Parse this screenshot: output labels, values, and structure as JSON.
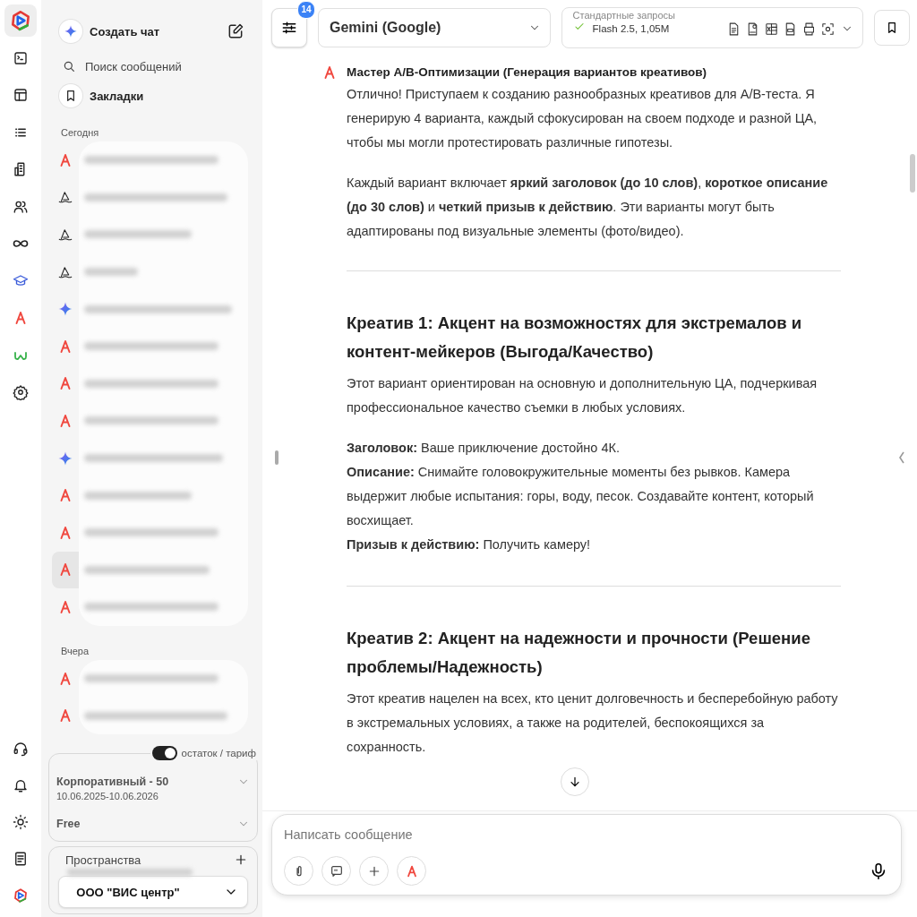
{
  "rail": {
    "top": [
      {
        "kind": "logo",
        "selected": true
      },
      {
        "kind": "terminal",
        "selected": false
      },
      {
        "kind": "layout",
        "selected": false
      },
      {
        "kind": "list",
        "selected": false
      },
      {
        "kind": "building",
        "selected": false
      },
      {
        "kind": "users",
        "selected": false
      },
      {
        "kind": "infinity",
        "selected": false
      },
      {
        "kind": "graduation",
        "selected": false
      },
      {
        "kind": "assistant",
        "selected": false
      },
      {
        "kind": "omega",
        "selected": false
      },
      {
        "kind": "settings",
        "selected": false
      }
    ],
    "bottom": [
      {
        "kind": "headset"
      },
      {
        "kind": "bell"
      },
      {
        "kind": "sun"
      },
      {
        "kind": "document"
      },
      {
        "kind": "logo"
      }
    ]
  },
  "sidebar": {
    "new_chat": "Создать чат",
    "search": {
      "placeholder": "Поиск сообщений"
    },
    "bookmarks": "Закладки",
    "groups": [
      {
        "label": "Сегодня",
        "chats": [
          {
            "kind": "assistant",
            "selected": false
          },
          {
            "kind": "sail",
            "selected": false
          },
          {
            "kind": "sail",
            "selected": false
          },
          {
            "kind": "sail",
            "selected": false
          },
          {
            "kind": "gemini",
            "selected": false
          },
          {
            "kind": "assistant",
            "selected": false
          },
          {
            "kind": "assistant",
            "selected": false
          },
          {
            "kind": "assistant",
            "selected": false
          },
          {
            "kind": "gemini",
            "selected": false
          },
          {
            "kind": "assistant",
            "selected": false
          },
          {
            "kind": "assistant",
            "selected": false
          },
          {
            "kind": "assistant",
            "selected": true
          },
          {
            "kind": "assistant",
            "selected": false
          }
        ]
      },
      {
        "label": "Вчера",
        "chats": [
          {
            "kind": "assistant",
            "selected": false
          },
          {
            "kind": "assistant",
            "selected": false
          }
        ]
      }
    ],
    "plan_panel": {
      "toggle": {
        "label": "остаток / тариф",
        "on": true
      },
      "plans": [
        {
          "name": "Корпоративный - 50",
          "dates": "10.06.2025-10.06.2026"
        },
        {
          "name": "Free"
        }
      ]
    },
    "spaces": {
      "title": "Пространства",
      "selected": "ООО \"ВИС центр\""
    }
  },
  "topbar": {
    "filters_badge": "14",
    "model": "Gemini (Google)",
    "requests": {
      "label": "Стандартные запросы",
      "value": "Flash 2.5, 1,05M"
    }
  },
  "message": {
    "title": "Мастер A/B-Оптимизации (Генерация вариантов креативов)",
    "blocks": [
      {
        "kind": "paragraph",
        "text": "Отлично! Приступаем к созданию разнообразных креативов для A/B-теста. Я генерирую 4 варианта, каждый сфокусирован на своем подходе и разной ЦА, чтобы мы могли протестировать различные гипотезы."
      },
      {
        "kind": "paragraph",
        "text": "Каждый вариант включает **яркий заголовок (до 10 слов)**, **короткое описание (до 30 слов)** и **четкий призыв к действию**. Эти варианты могут быть адаптированы под визуальные элементы (фото/видео)."
      },
      {
        "kind": "divider"
      },
      {
        "kind": "heading",
        "text": "Креатив 1: Акцент на возможностях для экстремалов и контент-мейкеров (Выгода/Качество)"
      },
      {
        "kind": "paragraph",
        "text": "Этот вариант ориентирован на основную и дополнительную ЦА, подчеркивая профессиональное качество съемки в любых условиях."
      },
      {
        "kind": "line",
        "text": "**Заголовок:** Ваше приключение достойно 4К."
      },
      {
        "kind": "line",
        "text": "**Описание:** Снимайте головокружительные моменты без рывков. Камера выдержит любые испытания: горы, воду, песок. Создавайте контент, который восхищает."
      },
      {
        "kind": "line",
        "text": "**Призыв к действию:** Получить камеру!"
      },
      {
        "kind": "divider"
      },
      {
        "kind": "heading",
        "text": "Креатив 2: Акцент на надежности и прочности (Решение проблемы/Надежность)"
      },
      {
        "kind": "paragraph",
        "text": "Этот креатив нацелен на всех, кто ценит долговечность и бесперебойную работу в экстремальных условиях, а также на родителей, беспокоящихся за сохранность."
      }
    ]
  },
  "composer": {
    "placeholder": "Написать сообщение"
  }
}
